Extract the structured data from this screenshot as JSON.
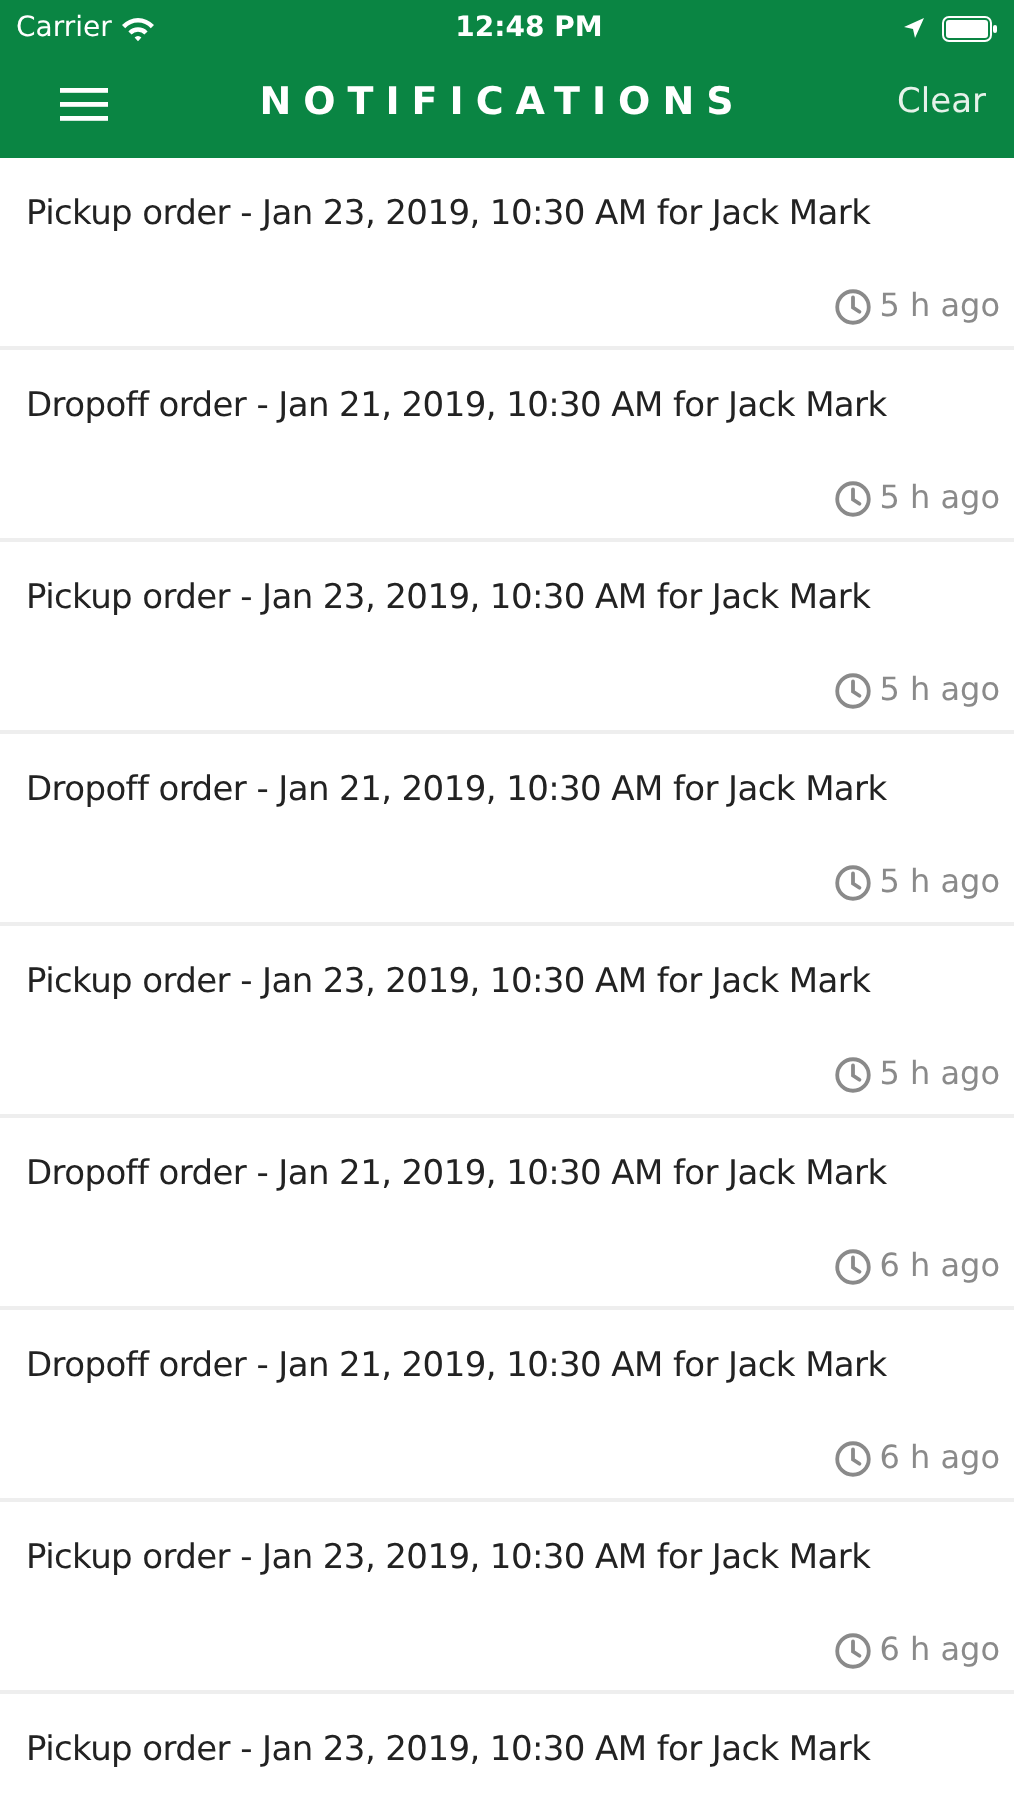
{
  "status_bar": {
    "carrier": "Carrier",
    "time": "12:48 PM"
  },
  "header": {
    "title": "NOTIFICATIONS",
    "action": "Clear"
  },
  "notifications": [
    {
      "text": "Pickup order - Jan 23, 2019, 10:30 AM for Jack Mark",
      "time": "5 h ago"
    },
    {
      "text": "Dropoff order - Jan 21, 2019, 10:30 AM for Jack Mark",
      "time": "5 h ago"
    },
    {
      "text": "Pickup order - Jan 23, 2019, 10:30 AM for Jack Mark",
      "time": "5 h ago"
    },
    {
      "text": "Dropoff order - Jan 21, 2019, 10:30 AM for Jack Mark",
      "time": "5 h ago"
    },
    {
      "text": "Pickup order - Jan 23, 2019, 10:30 AM for Jack Mark",
      "time": "5 h ago"
    },
    {
      "text": "Dropoff order - Jan 21, 2019, 10:30 AM for Jack Mark",
      "time": "6 h ago"
    },
    {
      "text": "Dropoff order - Jan 21, 2019, 10:30 AM for Jack Mark",
      "time": "6 h ago"
    },
    {
      "text": "Pickup order - Jan 23, 2019, 10:30 AM for Jack Mark",
      "time": "6 h ago"
    },
    {
      "text": "Pickup order - Jan 23, 2019, 10:30 AM for Jack Mark"
    }
  ]
}
